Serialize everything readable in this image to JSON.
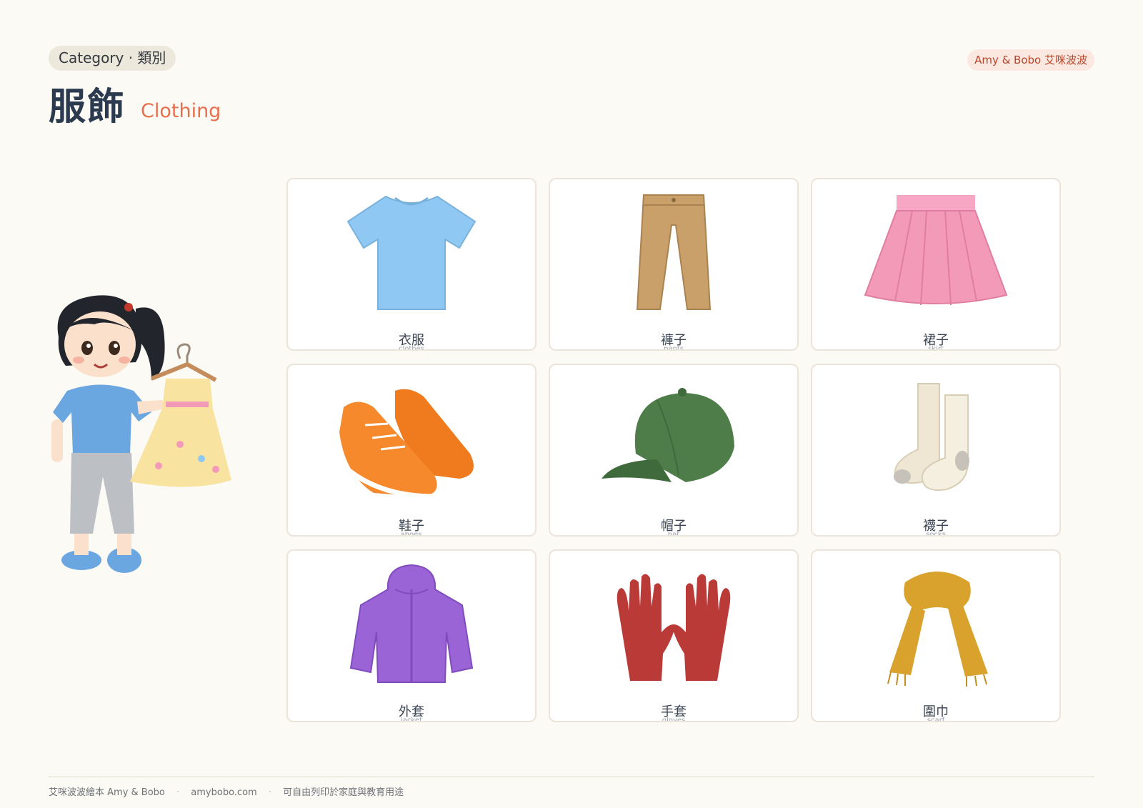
{
  "header": {
    "category_badge": "Category · 類別",
    "brand_badge": "Amy & Bobo 艾咪波波",
    "title_zh": "服飾",
    "title_en": "Clothing"
  },
  "illustration": {
    "icon": "girl-holding-dress-icon"
  },
  "cards": [
    {
      "zh": "衣服",
      "en": "clothes",
      "icon": "tshirt-icon",
      "color": "#8fc8f2"
    },
    {
      "zh": "褲子",
      "en": "pants",
      "icon": "pants-icon",
      "color": "#c9a06a"
    },
    {
      "zh": "裙子",
      "en": "skirt",
      "icon": "skirt-icon",
      "color": "#f29ab8"
    },
    {
      "zh": "鞋子",
      "en": "shoes",
      "icon": "shoes-icon",
      "color": "#f07a1e"
    },
    {
      "zh": "帽子",
      "en": "hat",
      "icon": "cap-icon",
      "color": "#4f7d4a"
    },
    {
      "zh": "襪子",
      "en": "socks",
      "icon": "socks-icon",
      "color": "#efe7d4"
    },
    {
      "zh": "外套",
      "en": "jacket",
      "icon": "jacket-icon",
      "color": "#9a63d6"
    },
    {
      "zh": "手套",
      "en": "gloves",
      "icon": "gloves-icon",
      "color": "#b93a36"
    },
    {
      "zh": "圍巾",
      "en": "scarf",
      "icon": "scarf-icon",
      "color": "#d8a22c"
    }
  ],
  "footer": {
    "brand": "艾咪波波繪本  Amy & Bobo",
    "site": "amybobo.com",
    "note": "可自由列印於家庭與教育用途",
    "separator": "·"
  }
}
